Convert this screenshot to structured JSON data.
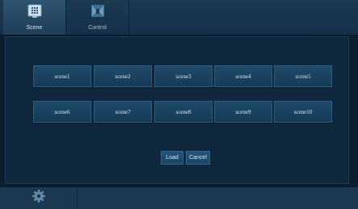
{
  "tabs": [
    {
      "label": "Scene",
      "icon": "scene-grid-icon",
      "active": true
    },
    {
      "label": "Control",
      "icon": "control-camera-icon",
      "active": false
    }
  ],
  "scenes": [
    "scene1",
    "scene2",
    "scene3",
    "scene4",
    "scene5",
    "scene6",
    "scene7",
    "scene8",
    "scene9",
    "scene10"
  ],
  "actions": {
    "load_label": "Load",
    "cancel_label": "Cancel"
  },
  "bottom": {
    "settings_icon": "gear-icon"
  },
  "colors": {
    "background": "#0c1e2e",
    "panel": "#10283d",
    "button": "#1f4a6b",
    "text": "#dce9f3"
  }
}
